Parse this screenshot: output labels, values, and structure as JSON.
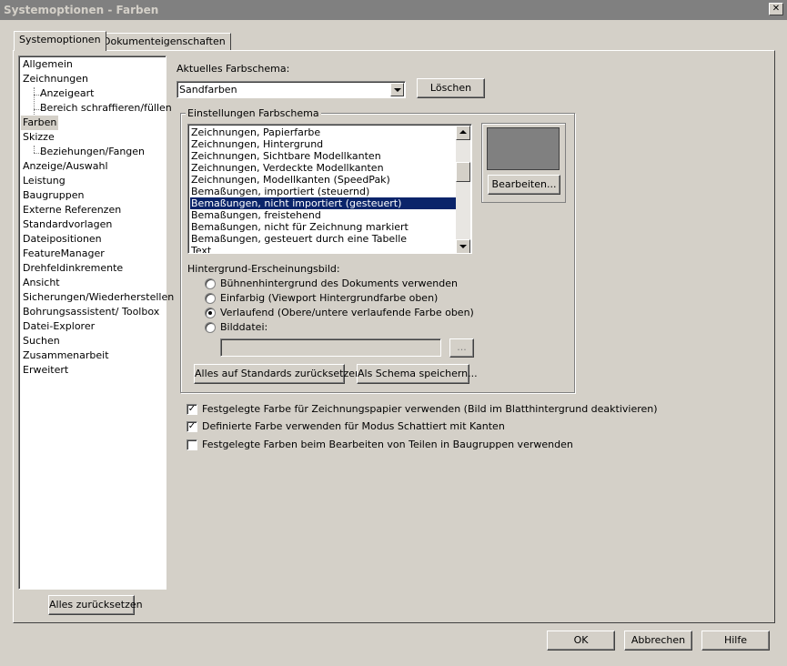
{
  "window": {
    "title": "Systemoptionen - Farben",
    "close_glyph": "✕"
  },
  "tabs": [
    {
      "label": "Systemoptionen",
      "active": true
    },
    {
      "label": "Dokumenteigenschaften",
      "active": false
    }
  ],
  "tree": {
    "items": [
      {
        "label": "Allgemein"
      },
      {
        "label": "Zeichnungen"
      },
      {
        "label": "Anzeigeart"
      },
      {
        "label": "Bereich schraffieren/füllen"
      },
      {
        "label": "Farben",
        "selected": true
      },
      {
        "label": "Skizze"
      },
      {
        "label": "Beziehungen/Fangen"
      },
      {
        "label": "Anzeige/Auswahl"
      },
      {
        "label": "Leistung"
      },
      {
        "label": "Baugruppen"
      },
      {
        "label": "Externe Referenzen"
      },
      {
        "label": "Standardvorlagen"
      },
      {
        "label": "Dateipositionen"
      },
      {
        "label": "FeatureManager"
      },
      {
        "label": "Drehfeldinkremente"
      },
      {
        "label": "Ansicht"
      },
      {
        "label": "Sicherungen/Wiederherstellen"
      },
      {
        "label": "Bohrungsassistent/ Toolbox"
      },
      {
        "label": "Datei-Explorer"
      },
      {
        "label": "Suchen"
      },
      {
        "label": "Zusammenarbeit"
      },
      {
        "label": "Erweitert"
      }
    ],
    "reset_all_label": "Alles zurücksetzen"
  },
  "scheme": {
    "label": "Aktuelles Farbschema:",
    "value": "Sandfarben",
    "delete_label": "Löschen"
  },
  "settings": {
    "group_title": "Einstellungen Farbschema",
    "items": [
      "Zeichnungen, Papierfarbe",
      "Zeichnungen, Hintergrund",
      "Zeichnungen, Sichtbare Modellkanten",
      "Zeichnungen, Verdeckte Modellkanten",
      "Zeichnungen, Modellkanten (SpeedPak)",
      "Bemaßungen, importiert (steuernd)",
      "Bemaßungen, nicht importiert (gesteuert)",
      "Bemaßungen, freistehend",
      "Bemaßungen, nicht für Zeichnung markiert",
      "Bemaßungen, gesteuert durch eine Tabelle",
      "Text"
    ],
    "selected_index": 6,
    "swatch_color": "#808080",
    "edit_label": "Bearbeiten...",
    "background_label": "Hintergrund-Erscheinungsbild:",
    "background_options": [
      {
        "label": "Bühnenhintergrund des Dokuments verwenden",
        "checked": false
      },
      {
        "label": "Einfarbig (Viewport Hintergrundfarbe oben)",
        "checked": false
      },
      {
        "label": "Verlaufend (Obere/untere verlaufende Farbe oben)",
        "checked": true
      },
      {
        "label": "Bilddatei:",
        "checked": false
      }
    ],
    "browse_label": "...",
    "reset_defaults_label": "Alles auf Standards zurücksetzen",
    "save_scheme_label": "Als Schema speichern..."
  },
  "checkboxes": [
    {
      "label": "Festgelegte Farbe für Zeichnungspapier verwenden (Bild im Blatthintergrund deaktivieren)",
      "checked": true
    },
    {
      "label": "Definierte Farbe verwenden für Modus Schattiert mit Kanten",
      "checked": true
    },
    {
      "label": "Festgelegte Farben beim Bearbeiten von Teilen in Baugruppen verwenden",
      "checked": false
    }
  ],
  "footer": {
    "ok": "OK",
    "cancel": "Abbrechen",
    "help": "Hilfe"
  }
}
